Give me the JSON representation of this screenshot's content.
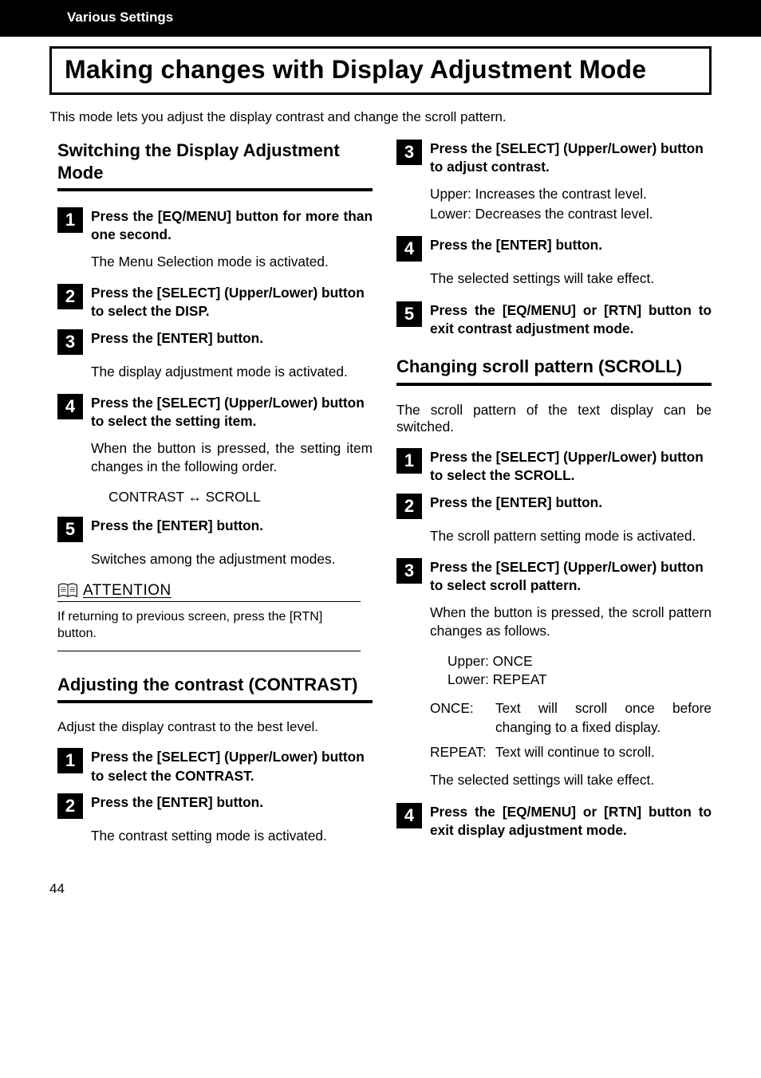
{
  "header": {
    "breadcrumb": "Various Settings"
  },
  "title": "Making changes with Display Adjustment Mode",
  "intro": "This mode lets you adjust the display contrast and change the scroll pattern.",
  "left": {
    "sectionA": {
      "title": "Switching the Display Adjustment Mode",
      "steps": [
        {
          "n": "1",
          "head": "Press the [EQ/MENU] button for more than one second.",
          "body": "The Menu Selection mode is activated."
        },
        {
          "n": "2",
          "head": "Press the [SELECT] (Upper/Lower) button to select the DISP.",
          "body": ""
        },
        {
          "n": "3",
          "head": "Press the [ENTER] button.",
          "body": "The display adjustment mode is activated."
        },
        {
          "n": "4",
          "head": "Press the [SELECT] (Upper/Lower) button to select the setting item.",
          "body": "When the button is pressed, the setting item changes in the following order.",
          "extra": "CONTRAST ↔ SCROLL"
        },
        {
          "n": "5",
          "head": "Press the [ENTER] button.",
          "body": "Switches among the adjustment modes."
        }
      ],
      "attention": {
        "label": "ATTENTION",
        "body": "If returning to previous screen, press the [RTN] button."
      }
    },
    "sectionB": {
      "title": "Adjusting the contrast (CONTRAST)",
      "intro": "Adjust the display contrast to the best level.",
      "steps": [
        {
          "n": "1",
          "head": "Press the [SELECT] (Upper/Lower) button to select the CONTRAST.",
          "body": ""
        },
        {
          "n": "2",
          "head": "Press the [ENTER] button.",
          "body": "The contrast setting mode is activated."
        }
      ]
    }
  },
  "right": {
    "contrastCont": {
      "steps": [
        {
          "n": "3",
          "head": "Press the [SELECT] (Upper/Lower) button to adjust contrast.",
          "body1": "Upper: Increases the contrast level.",
          "body2": "Lower: Decreases the contrast level."
        },
        {
          "n": "4",
          "head": "Press the [ENTER] button.",
          "body": "The selected settings will take effect."
        },
        {
          "n": "5",
          "head": "Press the [EQ/MENU] or [RTN] button to exit contrast adjustment mode.",
          "body": ""
        }
      ]
    },
    "sectionC": {
      "title": "Changing scroll pattern (SCROLL)",
      "intro": "The scroll pattern of the text display can be switched.",
      "steps": [
        {
          "n": "1",
          "head": "Press the [SELECT] (Upper/Lower) button to select the SCROLL.",
          "body": ""
        },
        {
          "n": "2",
          "head": "Press the [ENTER] button.",
          "body": "The scroll pattern setting mode is activated."
        },
        {
          "n": "3",
          "head": "Press the [SELECT] (Upper/Lower) button to select scroll pattern.",
          "body": "When the button is pressed, the scroll pattern changes as follows.",
          "list": {
            "upper": "Upper: ONCE",
            "lower": "Lower: REPEAT"
          },
          "defs": [
            {
              "term": "ONCE:",
              "desc": "Text will scroll once before changing to a fixed display."
            },
            {
              "term": "REPEAT:",
              "desc": "Text will continue to scroll."
            }
          ],
          "after": "The selected settings will take effect."
        },
        {
          "n": "4",
          "head": "Press the [EQ/MENU] or [RTN] button to exit display adjustment mode.",
          "body": ""
        }
      ]
    }
  },
  "pageNumber": "44"
}
